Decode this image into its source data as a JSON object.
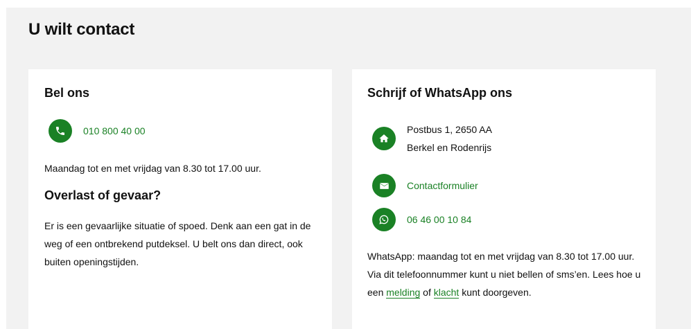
{
  "page": {
    "title": "U wilt contact"
  },
  "left_card": {
    "heading": "Bel ons",
    "phone": {
      "icon": "phone-icon",
      "number": "010 800 40 00"
    },
    "hours": "Maandag tot en met vrijdag van 8.30 tot 17.00 uur.",
    "emergency_heading": "Overlast of gevaar?",
    "emergency_text": "Er is een gevaarlijke situatie of spoed. Denk aan een gat in de weg of een ontbrekend putdeksel. U belt ons dan direct, ook buiten openingstijden."
  },
  "right_card": {
    "heading": "Schrijf of WhatsApp ons",
    "address": {
      "icon": "home-icon",
      "line1": "Postbus 1, 2650 AA",
      "line2": "Berkel en Rodenrijs"
    },
    "contact_form": {
      "icon": "envelope-icon",
      "label": "Contactformulier"
    },
    "whatsapp": {
      "icon": "whatsapp-icon",
      "number": "06 46 00 10 84"
    },
    "whatsapp_text": {
      "part1": "WhatsApp: maandag tot en met vrijdag van 8.30 tot 17.00 uur. Via dit telefoonnummer kunt u niet bellen of sms’en. Lees hoe u een ",
      "link1": "melding",
      "part2": " of ",
      "link2": "klacht",
      "part3": " kunt doorgeven."
    }
  },
  "colors": {
    "accent": "#1a8125",
    "panel_background": "#f2f2f2",
    "card_background": "#ffffff",
    "text": "#111111"
  }
}
